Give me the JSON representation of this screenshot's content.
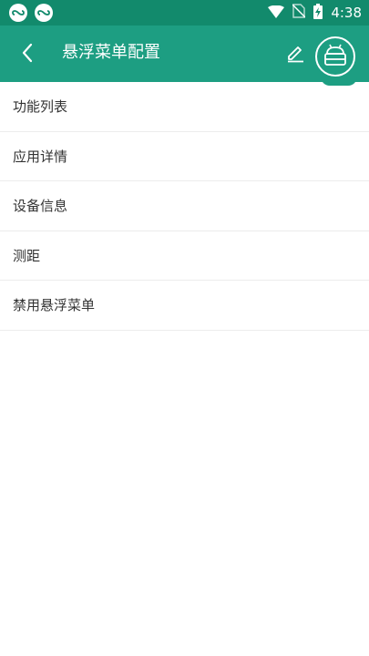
{
  "status_bar": {
    "time": "4:38",
    "icons": [
      "cloud-sync-icon",
      "cloud-sync-icon",
      "wifi-icon",
      "no-sim-icon",
      "battery-charging-icon"
    ]
  },
  "toolbar": {
    "title": "悬浮菜单配置",
    "back_icon": "chevron-left-icon",
    "edit_icon": "pencil-icon",
    "fab_icon": "android-robot-icon"
  },
  "menu": {
    "items": [
      {
        "label": "功能列表"
      },
      {
        "label": "应用详情"
      },
      {
        "label": "设备信息"
      },
      {
        "label": "测距"
      },
      {
        "label": "禁用悬浮菜单"
      }
    ]
  },
  "colors": {
    "status_bar": "#128a6c",
    "toolbar": "#1d9e82",
    "divider": "#ececec",
    "text": "#333333"
  }
}
